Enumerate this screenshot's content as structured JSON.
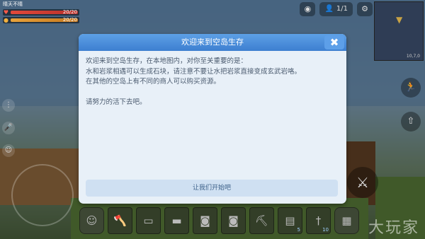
{
  "dialog": {
    "title": "欢迎来到空岛生存",
    "close_icon": "close-icon",
    "lines": [
      "欢迎来到空岛生存，在本地图内，对你至关重要的是：",
      "水和岩浆相遇可以生成石块，请注意不要让水把岩浆直接变成玄武岩咯。",
      "在其他的空岛上有不同的商人可以购买资源。",
      "请努力的活下去吧。"
    ],
    "start_button": "让我们开始吧"
  },
  "hud": {
    "player_name": "晴天不晴",
    "health": {
      "value": "20/20",
      "fraction": 1.0,
      "icon": "heart-icon"
    },
    "hunger": {
      "value": "20/20",
      "fraction": 1.0,
      "icon": "drumstick-icon"
    },
    "player_count": "1/1",
    "icons": [
      "camera-icon",
      "person-icon",
      "settings-icon"
    ],
    "minimap_coord": "10,7,0"
  },
  "hotbar": {
    "slots": [
      {
        "icon": "backpack-icon",
        "count": ""
      },
      {
        "icon": "axe-icon",
        "count": ""
      },
      {
        "icon": "crafting-table-icon",
        "count": ""
      },
      {
        "icon": "chest-icon",
        "count": ""
      },
      {
        "icon": "bucket-icon",
        "count": ""
      },
      {
        "icon": "bucket-icon",
        "count": ""
      },
      {
        "icon": "pickaxe-icon",
        "count": ""
      },
      {
        "icon": "seed-bag-icon",
        "count": "5"
      },
      {
        "icon": "torch-icon",
        "count": "10"
      },
      {
        "icon": "inventory-icon",
        "count": ""
      }
    ]
  },
  "watermark": "大玩家",
  "colors": {
    "dialog_header": "#3d7fd0",
    "dialog_bg": "#e8f0f8",
    "button_bg": "#cfe0f2",
    "body_text": "#4a5a6e"
  }
}
